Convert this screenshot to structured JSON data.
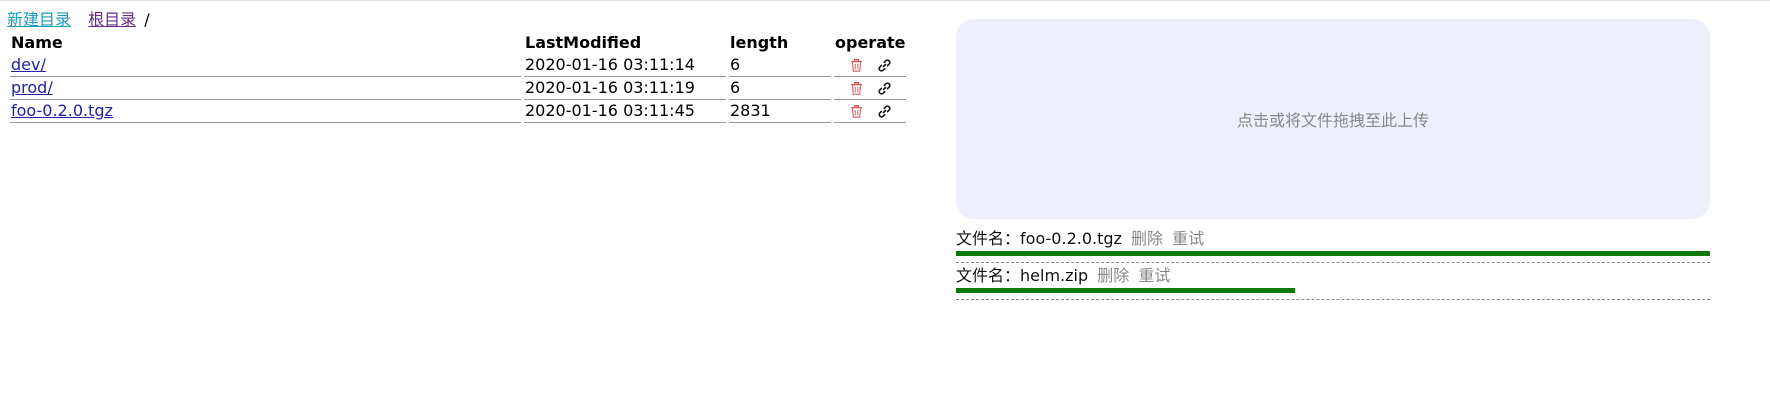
{
  "breadcrumb": {
    "new_dir_label": "新建目录",
    "root_label": "根目录",
    "separator": "/"
  },
  "table": {
    "headers": {
      "name": "Name",
      "modified": "LastModified",
      "length": "length",
      "operate": "operate"
    },
    "rows": [
      {
        "name": "dev/",
        "modified": "2020-01-16 03:11:14",
        "length": "6"
      },
      {
        "name": "prod/",
        "modified": "2020-01-16 03:11:19",
        "length": "6"
      },
      {
        "name": "foo-0.2.0.tgz",
        "modified": "2020-01-16 03:11:45",
        "length": "2831"
      }
    ],
    "operate_icons": [
      "trash-icon",
      "link-icon"
    ]
  },
  "upload": {
    "dropzone_text": "点击或将文件拖拽至此上传",
    "filename_label": "文件名：",
    "delete_label": "删除",
    "retry_label": "重试",
    "items": [
      {
        "filename": "foo-0.2.0.tgz",
        "progress": 1.0
      },
      {
        "filename": "helm.zip",
        "progress": 0.45
      }
    ]
  },
  "colors": {
    "progress": "#0c7a0c",
    "trash_icon": "#e05a5a",
    "dropzone_bg": "#eeeffc",
    "link": "#2222aa"
  }
}
